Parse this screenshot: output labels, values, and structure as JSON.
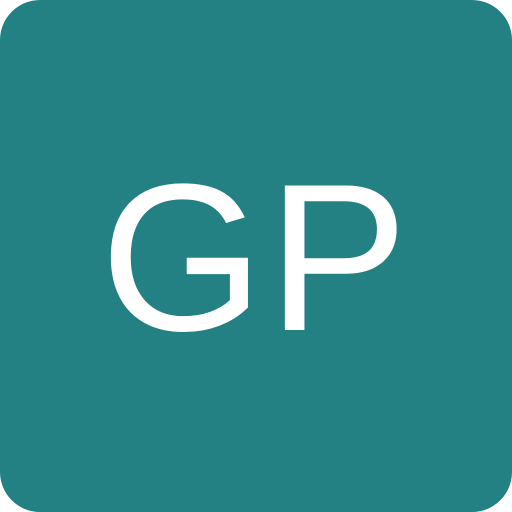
{
  "avatar": {
    "initials": "GP",
    "background_color": "#238183",
    "text_color": "#ffffff"
  }
}
